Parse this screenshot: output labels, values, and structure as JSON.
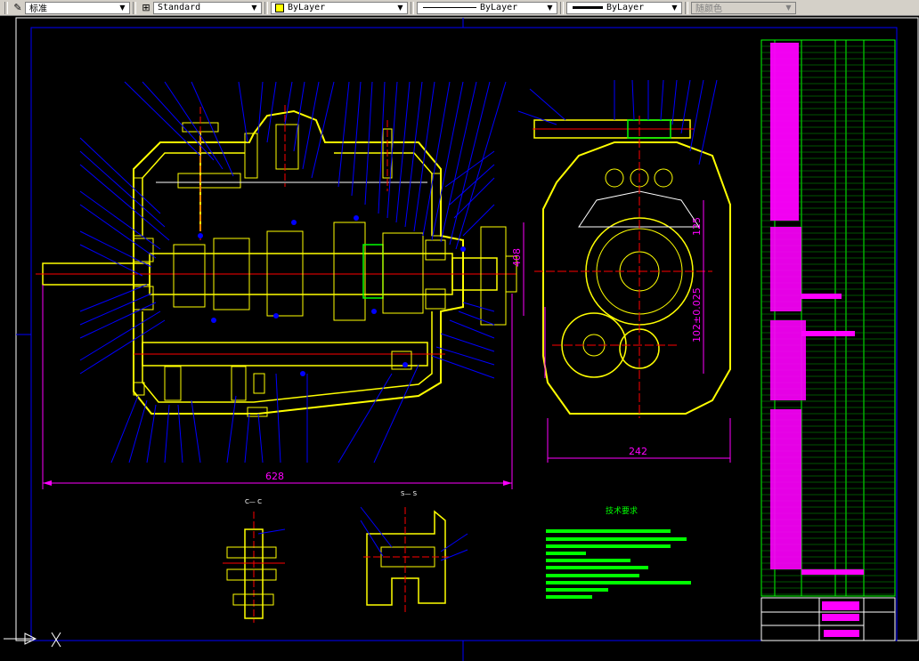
{
  "toolbar": {
    "text_style": "标准",
    "dim_style": "Standard",
    "layer_color": "ByLayer",
    "linetype": "ByLayer",
    "lineweight": "ByLayer",
    "plot_style": "随颜色"
  },
  "drawing": {
    "dim_length": "628",
    "dim_width": "242",
    "dim_height": "408",
    "dim_125": "125",
    "dim_102": "102±0.025",
    "section_c": "C— C",
    "section_s": "S— S",
    "tech_title": "技术要求"
  },
  "colors": {
    "frame": "#0000ff",
    "yellow": "#ffff00",
    "magenta": "#ff00ff",
    "green": "#00ff00",
    "red": "#ff0000",
    "cyan": "#00ffff",
    "white": "#ffffff"
  }
}
